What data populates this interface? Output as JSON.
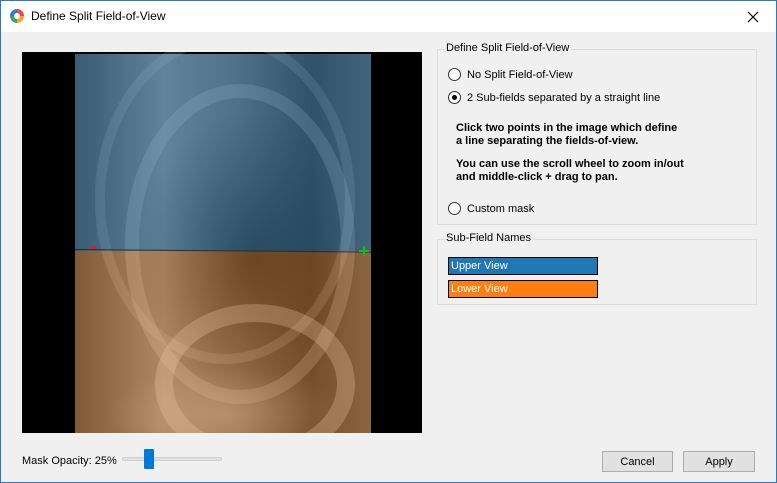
{
  "window": {
    "title": "Define Split Field-of-View",
    "icon": "app-logo-icon",
    "close_icon": "close-icon"
  },
  "split_group": {
    "title": "Define Split Field-of-View",
    "options": [
      {
        "label": "No Split Field-of-View",
        "selected": false
      },
      {
        "label": "2 Sub-fields separated by a straight line",
        "selected": true
      },
      {
        "label": "Custom mask",
        "selected": false
      }
    ],
    "instructions_1": [
      "Click two points in the image which define",
      "a line separating the fields-of-view."
    ],
    "instructions_2": [
      "You can use the scroll wheel to zoom in/out",
      "and middle-click + drag to pan."
    ]
  },
  "names_group": {
    "title": "Sub-Field Names",
    "fields": [
      {
        "value": "Upper View",
        "color": "#1f77b4"
      },
      {
        "value": "Lower View",
        "color": "#ff7f0e"
      }
    ]
  },
  "mask_opacity": {
    "label": "Mask Opacity: 25%",
    "value_percent": 25
  },
  "buttons": {
    "cancel": "Cancel",
    "apply": "Apply"
  }
}
